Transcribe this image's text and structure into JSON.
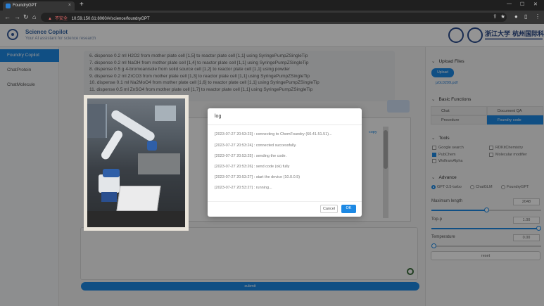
{
  "browser": {
    "tab_title": "FoundryGPT",
    "security_label": "不安全",
    "url": "10.59.150.61:8060/#/science/foundryGPT"
  },
  "header": {
    "brand": "Science Copilot",
    "subtitle": "Your AI assistant for science research",
    "university": "浙江大学 杭州国际科创"
  },
  "sidebar": {
    "items": [
      {
        "label": "Foundry Copilot",
        "active": true
      },
      {
        "label": "ChatProtein",
        "active": false
      },
      {
        "label": "ChatMolecule",
        "active": false
      }
    ]
  },
  "chat": {
    "steps": [
      "6. dispense 0.2 ml H2O2 from mother plate cell [1,5] to reactor plate cell [1,1] using SyringePumpZSingleTip",
      "7. dispense 0.2 ml NaOH from mother plate cell [1,4] to reactor plate cell [1,1] using SyringePumpZSingleTip",
      "8. dispense 0.5 g 4-bromoanisole from solid source cell [1,2] to reactor plate cell [1,1] using powder",
      "9. dispense 0.2 ml ZrCO3 from mother plate cell [1,3] to reactor plate cell [1,1] using SyringePumpZSingleTip",
      "10. dispense 0.1 ml Na2MoO4 from mother plate cell [1,6] to reactor plate cell [1,1] using SyringePumpZSingleTip",
      "11. dispense 0.5 ml ZnSO4 from mother plate cell [1,7] to reactor plate cell [1,1] using SyringePumpZSingleTip"
    ],
    "copy_label": "copy",
    "submit_label": "submit"
  },
  "right_panel": {
    "upload": {
      "title": "Upload Files",
      "button": "Upload",
      "file": "jz0c0299.pdf"
    },
    "basic": {
      "title": "Basic Functions",
      "items": [
        {
          "label": "Chat",
          "selected": false
        },
        {
          "label": "Document QA",
          "selected": false
        },
        {
          "label": "Procedure",
          "selected": false
        },
        {
          "label": "Foundry code",
          "selected": true
        }
      ]
    },
    "tools": {
      "title": "Tools",
      "items": [
        {
          "label": "Google search",
          "checked": false
        },
        {
          "label": "RDKitChemistry",
          "checked": false
        },
        {
          "label": "PubChem",
          "checked": true
        },
        {
          "label": "Molecular modifier",
          "checked": false
        },
        {
          "label": "WolframAlpha",
          "checked": false
        }
      ]
    },
    "advance": {
      "title": "Advance",
      "models": [
        {
          "label": "GPT-3.5-turbo",
          "selected": true
        },
        {
          "label": "ChatGLM",
          "selected": false
        },
        {
          "label": "FoundryGPT",
          "selected": false
        }
      ],
      "max_length_label": "Maximum length",
      "max_length_value": "2048",
      "max_length_fraction": 0.5,
      "top_p_label": "Top-p",
      "top_p_value": "1.00",
      "top_p_fraction": 1.0,
      "temperature_label": "Temperature",
      "temperature_value": "0.00",
      "temperature_fraction": 0.0,
      "reset_label": "reset"
    }
  },
  "modal": {
    "title": "log",
    "lines": [
      "[2023-07-27 20:53:23] : connecting to ChemFoundry (60.41.51.51)...",
      "[2023-07-27 20:53:24] : connected successfully.",
      "[2023-07-27 20:53:25] : sending the code.",
      "[2023-07-27 20:53:26] : send code (ok) fully",
      "[2023-07-27 20:53:27] : start the device (10.0.0.5)",
      "[2023-07-27 20:53:27] : running..."
    ],
    "cancel": "Cancel",
    "ok": "OK"
  }
}
